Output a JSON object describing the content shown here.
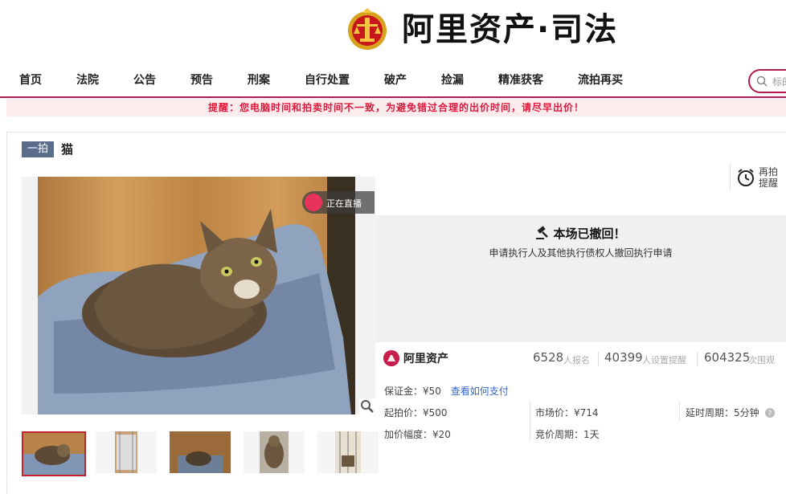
{
  "header": {
    "logo_text": "阿里资产·司法"
  },
  "nav": {
    "items": [
      "首页",
      "法院",
      "公告",
      "预告",
      "刑案",
      "自行处置",
      "破产",
      "捡漏",
      "精准获客",
      "流拍再买"
    ],
    "search_placeholder": "标的"
  },
  "notice": "提醒：您电脑时间和拍卖时间不一致，为避免错过合理的出价时间，请尽早出价！",
  "item": {
    "badge": "一拍",
    "title": "猫",
    "live_label": "正在直播",
    "remind_line1": "再拍",
    "remind_line2": "提醒"
  },
  "status": {
    "heading": "本场已撤回！",
    "detail": "申请执行人及其他执行债权人撤回执行申请"
  },
  "stats": {
    "brand": "阿里资产",
    "signups": "6528",
    "signups_label": "人报名",
    "reminders": "40399",
    "reminders_label": "人设置提醒",
    "views": "604325",
    "views_label": "次围观"
  },
  "details": {
    "deposit": "保证金：¥50",
    "how_to_pay": "查看如何支付",
    "start_price": "起拍价：¥500",
    "market_price": "市场价：¥714",
    "delay_period": "延时周期：5分钟",
    "increment": "加价幅度：¥20",
    "bid_period": "竞价周期：1天"
  },
  "colors": {
    "brand": "#b01b52",
    "notice_text": "#e0183c",
    "badge_bg": "#5a6e8c"
  }
}
